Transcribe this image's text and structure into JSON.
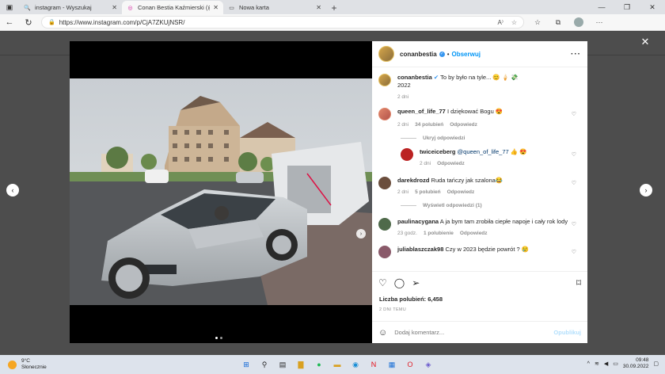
{
  "browser": {
    "tabs": [
      {
        "title": "instagram - Wyszukaj",
        "icon": "search-icon",
        "active": false
      },
      {
        "title": "Conan Bestia Kaźmierski (@conan",
        "icon": "instagram-icon",
        "active": true
      },
      {
        "title": "Nowa karta",
        "icon": "newtab-icon",
        "active": false
      }
    ],
    "url": "https://www.instagram.com/p/CjA7ZKUjNSR/"
  },
  "post": {
    "username": "conanbestia",
    "follow_label": "Obserwuj",
    "caption": {
      "user": "conanbestia",
      "text": "To by było na tyle... 😊 🍦 💸",
      "year": "2022",
      "time": "2 dni"
    },
    "comments": [
      {
        "user": "queen_of_life_77",
        "text": "I dziękować Bogu 😍",
        "time": "2 dni",
        "likes": "34 polubień",
        "reply": "Odpowiedz",
        "toggle": "Ukryj odpowiedzi",
        "replies": [
          {
            "user": "twiceiceberg",
            "mention": "@queen_of_life_77",
            "text": "👍 😍",
            "time": "2 dni",
            "reply": "Odpowiedz"
          }
        ]
      },
      {
        "user": "darekdrozd",
        "text": "Ruda tańczy jak szalona😂",
        "time": "2 dni",
        "likes": "5 polubień",
        "reply": "Odpowiedz",
        "toggle": "Wyświetl odpowiedzi (1)"
      },
      {
        "user": "paulinacygana",
        "text": "A ja bym tam zrobiła ciepłe napoje i cały rok lody",
        "time": "23 godz.",
        "likes": "1 polubienie",
        "reply": "Odpowiedz"
      },
      {
        "user": "juliablaszczak98",
        "text": "Czy w 2023 będzie powrót ? 😢"
      }
    ],
    "likes": "Liczba polubień: 6,458",
    "date": "2 DNI TEMU",
    "comment_placeholder": "Dodaj komentarz...",
    "post_label": "Opublikuj"
  },
  "taskbar": {
    "temperature": "9°C",
    "weather": "Słonecznie",
    "time": "09:48",
    "date": "30.09.2022"
  }
}
